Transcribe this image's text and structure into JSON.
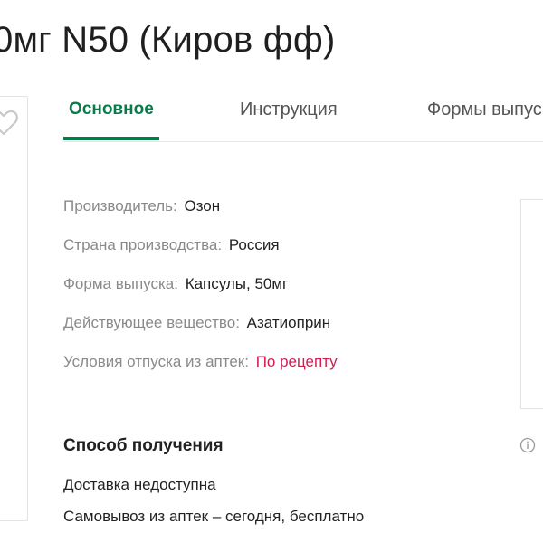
{
  "product": {
    "title": "0мг N50 (Киров фф)"
  },
  "tabs": [
    {
      "label": "Основное",
      "active": true
    },
    {
      "label": "Инструкция",
      "active": false
    },
    {
      "label": "Формы выпус",
      "active": false
    }
  ],
  "attributes": [
    {
      "label": "Производитель:",
      "value": "Озон"
    },
    {
      "label": "Страна производства:",
      "value": "Россия"
    },
    {
      "label": "Форма выпуска:",
      "value": "Капсулы, 50мг"
    },
    {
      "label": "Действующее вещество:",
      "value": "Азатиоприн"
    },
    {
      "label": "Условия отпуска из аптек:",
      "value": "По рецепту"
    }
  ],
  "delivery": {
    "title": "Способ получения",
    "lines": [
      "Доставка недоступна",
      "Самовывоз из аптек – сегодня, бесплатно"
    ]
  },
  "icons": {
    "favorite": "heart-icon",
    "info": "info-icon"
  },
  "colors": {
    "accent": "#0b7a4b",
    "prescription": "#d21d52",
    "label": "#8a8a8a",
    "border": "#e3e3e3"
  }
}
